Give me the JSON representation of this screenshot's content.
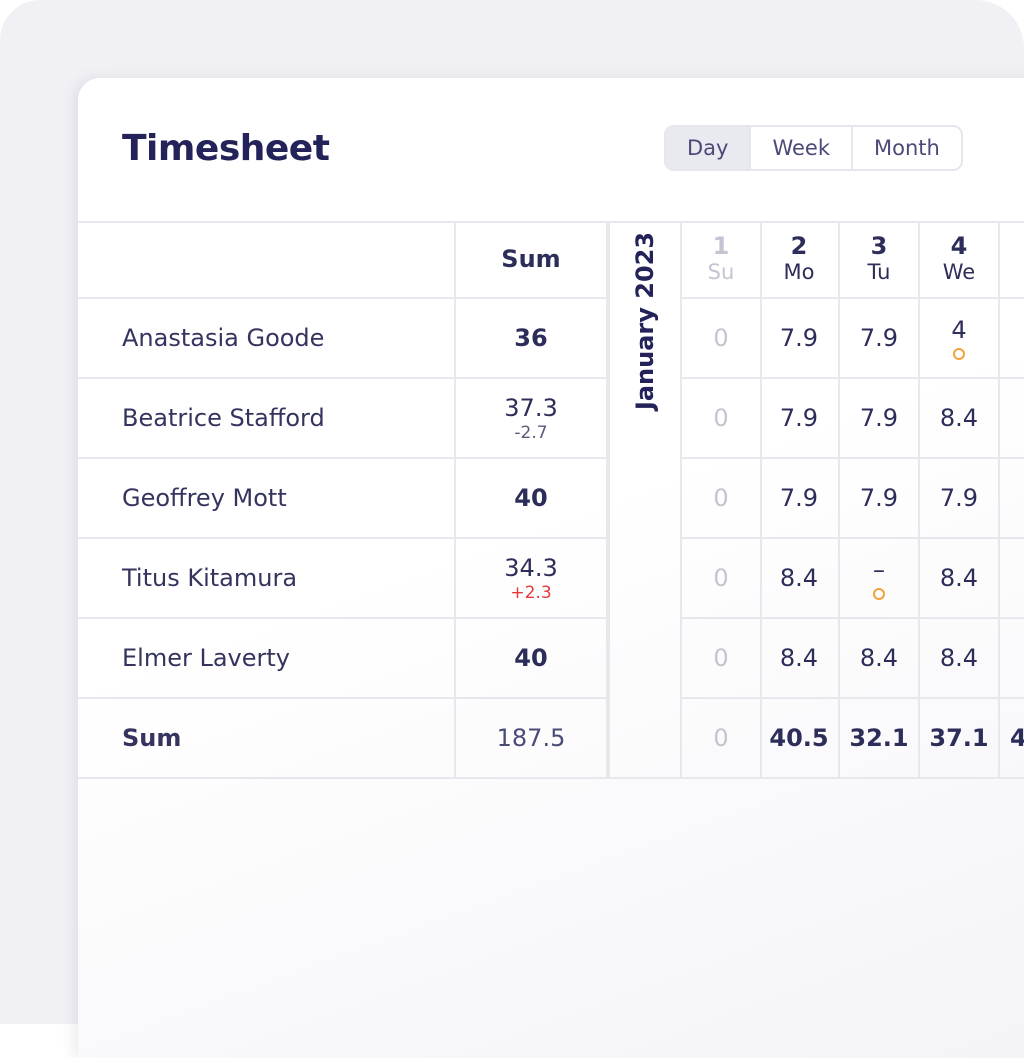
{
  "title": "Timesheet",
  "view_options": [
    "Day",
    "Week",
    "Month"
  ],
  "selected_view": "Day",
  "month_label": "January 2023",
  "sum_header": "Sum",
  "days": [
    {
      "num": "1",
      "name": "Su",
      "weekend": true
    },
    {
      "num": "2",
      "name": "Mo"
    },
    {
      "num": "3",
      "name": "Tu"
    },
    {
      "num": "4",
      "name": "We"
    }
  ],
  "rows": [
    {
      "name": "Anastasia Goode",
      "sum": "36",
      "delta": "",
      "values": [
        "0",
        "7.9",
        "7.9",
        "4"
      ],
      "flags": [
        false,
        false,
        false,
        true
      ]
    },
    {
      "name": "Beatrice Stafford",
      "sum": "37.3",
      "delta": "-2.7",
      "values": [
        "0",
        "7.9",
        "7.9",
        "8.4"
      ],
      "flags": [
        false,
        false,
        false,
        false
      ]
    },
    {
      "name": "Geoffrey Mott",
      "sum": "40",
      "delta": "",
      "values": [
        "0",
        "7.9",
        "7.9",
        "7.9"
      ],
      "flags": [
        false,
        false,
        false,
        false
      ]
    },
    {
      "name": "Titus Kitamura",
      "sum": "34.3",
      "delta": "+2.3",
      "values": [
        "0",
        "8.4",
        "–",
        "8.4"
      ],
      "flags": [
        false,
        false,
        true,
        false
      ]
    },
    {
      "name": "Elmer Laverty",
      "sum": "40",
      "delta": "",
      "values": [
        "0",
        "8.4",
        "8.4",
        "8.4"
      ],
      "flags": [
        false,
        false,
        false,
        false
      ]
    }
  ],
  "totals": {
    "label": "Sum",
    "sum": "187.5",
    "values": [
      "0",
      "40.5",
      "32.1",
      "37.1",
      "4"
    ]
  },
  "colors": {
    "accent": "#23235a",
    "warning_dot": "#f3a33a",
    "negative_delta": "#e5383b"
  }
}
